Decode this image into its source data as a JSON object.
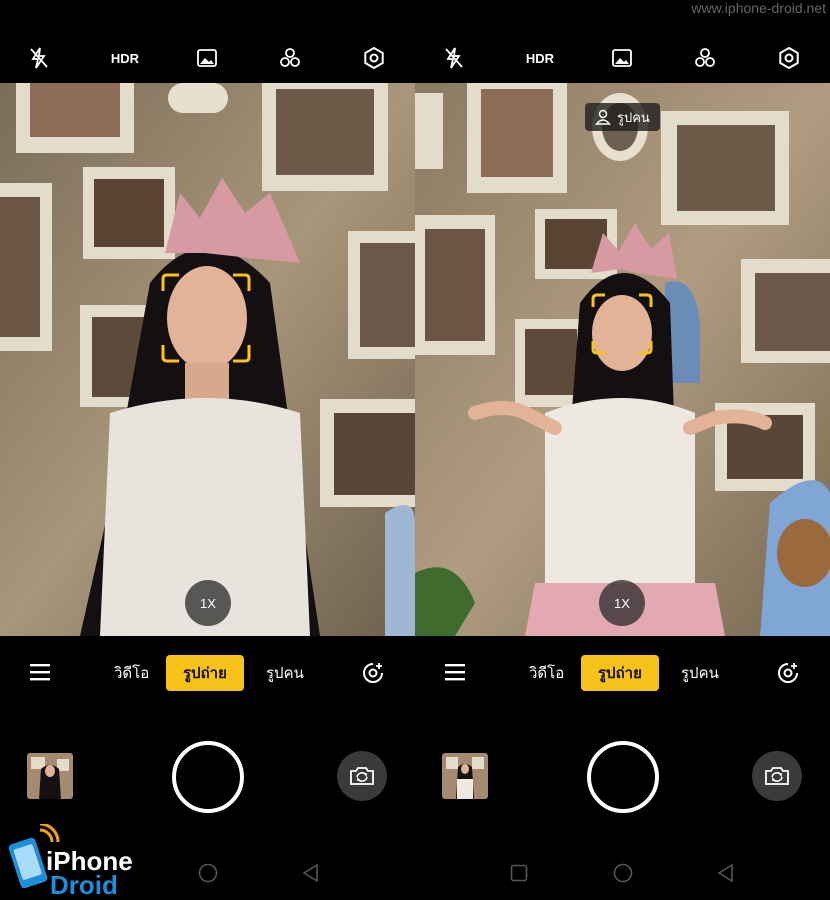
{
  "watermark": "www.iphone-droid.net",
  "topbar": {
    "icons": [
      "flash-off-icon",
      "hdr-icon",
      "image-filter-icon",
      "beauty-filter-icon",
      "settings-icon"
    ],
    "hdr_label": "HDR"
  },
  "left": {
    "zoom": "1X",
    "modes": [
      "วิดีโอ",
      "รูปถ่าย",
      "รูปคน"
    ],
    "active_mode": "รูปถ่าย"
  },
  "right": {
    "zoom": "1X",
    "portrait_chip": "รูปคน",
    "modes": [
      "วิดีโอ",
      "รูปถ่าย",
      "รูปคน"
    ],
    "active_mode": "รูปถ่าย"
  },
  "logo": {
    "line1": "iPhone",
    "line2": "Droid"
  },
  "colors": {
    "accent": "#f7c31a",
    "face_frame": "#ffc21a"
  }
}
